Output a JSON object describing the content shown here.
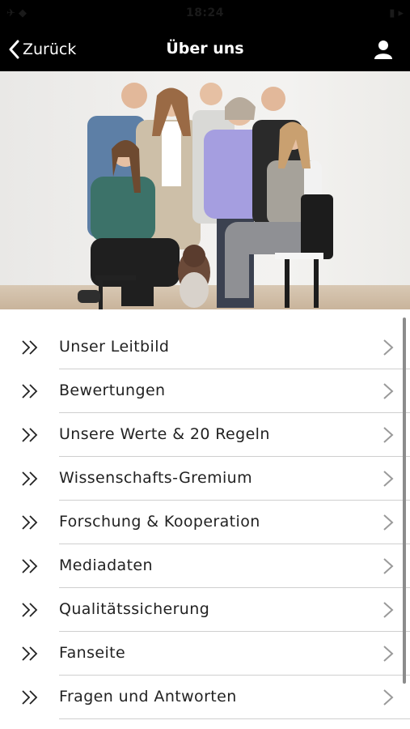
{
  "status_bar": {
    "time": "18:24"
  },
  "nav": {
    "back_label": "Zurück",
    "title": "Über uns"
  },
  "menu": {
    "items": [
      {
        "label": "Unser Leitbild"
      },
      {
        "label": "Bewertungen"
      },
      {
        "label": "Unsere Werte & 20 Regeln"
      },
      {
        "label": "Wissenschafts-Gremium"
      },
      {
        "label": "Forschung & Kooperation"
      },
      {
        "label": "Mediadaten"
      },
      {
        "label": "Qualitätssicherung"
      },
      {
        "label": "Fanseite"
      },
      {
        "label": "Fragen und Antworten"
      }
    ]
  },
  "colors": {
    "nav_background": "#000000",
    "nav_text": "#ffffff",
    "list_text": "#222222",
    "chevron": "#9a9a9a",
    "separator": "#cfcfcf"
  },
  "icons": {
    "back": "chevron-left-icon",
    "profile": "user-icon",
    "item_bullet": "double-chevron-right-icon",
    "item_disclosure": "chevron-right-icon"
  }
}
